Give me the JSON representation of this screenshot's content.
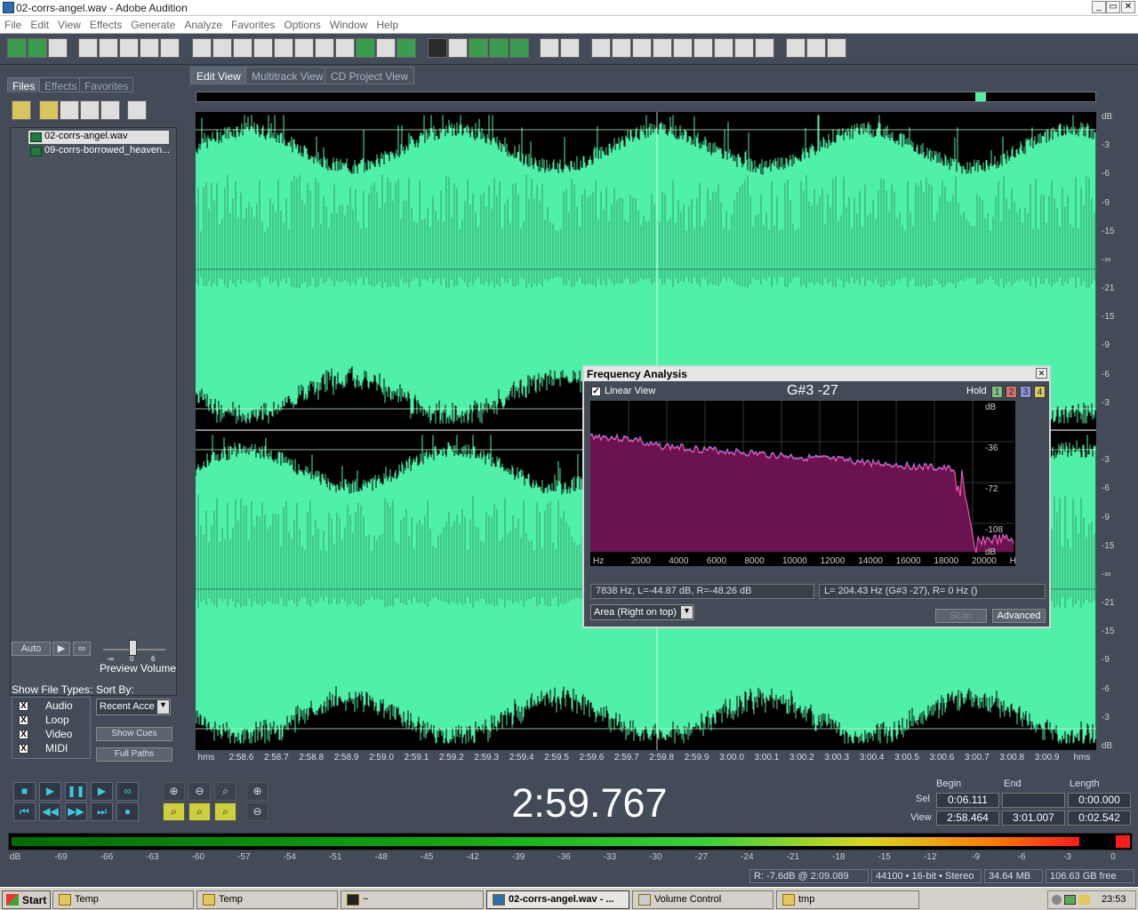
{
  "window": {
    "title": "02-corrs-angel.wav - Adobe Audition",
    "controls": [
      "_",
      "▭",
      "✕"
    ]
  },
  "menu": [
    "File",
    "Edit",
    "View",
    "Effects",
    "Generate",
    "Analyze",
    "Favorites",
    "Options",
    "Window",
    "Help"
  ],
  "left_panel": {
    "tabs": [
      "Files",
      "Effects",
      "Favorites"
    ],
    "files": [
      "02-corrs-angel.wav",
      "09-corrs-borrowed_heaven..."
    ],
    "auto_label": "Auto",
    "preview_volume_label": "Preview Volume",
    "preview_scale": [
      "-∞",
      "0",
      "6"
    ],
    "show_file_types_label": "Show File Types:",
    "sort_by_label": "Sort By:",
    "sort_value": "Recent Acce",
    "file_types": [
      "Audio",
      "Loop",
      "Video",
      "MIDI"
    ],
    "show_cues": "Show Cues",
    "full_paths": "Full Paths"
  },
  "view_tabs": [
    "Edit View",
    "Multitrack View",
    "CD Project View"
  ],
  "db_scale": [
    "dB",
    "-3",
    "-6",
    "-9",
    "-15",
    "-∞",
    "-21",
    "-15",
    "-9",
    "-6",
    "-3",
    "",
    "-3",
    "-6",
    "-9",
    "-15",
    "-∞",
    "-21",
    "-15",
    "-9",
    "-6",
    "-3",
    "dB"
  ],
  "timeline": [
    "hms",
    "2:58.6",
    "2:58.7",
    "2:58.8",
    "2:58.9",
    "2:59.0",
    "2:59.1",
    "2:59.2",
    "2:59.3",
    "2:59.4",
    "2:59.5",
    "2:59.6",
    "2:59.7",
    "2:59.8",
    "2:59.9",
    "3:00.0",
    "3:00.1",
    "3:00.2",
    "3:00.3",
    "3:00.4",
    "3:00.5",
    "3:00.6",
    "3:00.7",
    "3:00.8",
    "3:00.9",
    "hms"
  ],
  "freq_dialog": {
    "title": "Frequency Analysis",
    "linear_view": "Linear View",
    "note": "G#3 -27",
    "hold": "Hold",
    "hold_buttons": [
      "1",
      "2",
      "3",
      "4"
    ],
    "x_ticks": [
      "Hz",
      "2000",
      "4000",
      "6000",
      "8000",
      "10000",
      "12000",
      "14000",
      "16000",
      "18000",
      "20000",
      "Hz"
    ],
    "y_ticks": [
      "dB",
      "-36",
      "-72",
      "-108",
      "dB"
    ],
    "readout_left": "7838 Hz, L=-44.87 dB, R=-48.26 dB",
    "readout_right": "L= 204.43 Hz (G#3 -27), R=      0 Hz ()",
    "plot_mode": "Area (Right on top)",
    "scan": "Scan",
    "advanced": "Advanced"
  },
  "transport": {
    "time": "2:59.767",
    "headers": [
      "Begin",
      "End",
      "Length"
    ],
    "sel_label": "Sel",
    "view_label": "View",
    "sel": [
      "0:06.111",
      "",
      "0:00.000"
    ],
    "view": [
      "2:58.464",
      "3:01.007",
      "0:02.542"
    ]
  },
  "meter_scale": [
    "dB",
    "-69",
    "-66",
    "-63",
    "-60",
    "-57",
    "-54",
    "-51",
    "-48",
    "-45",
    "-42",
    "-39",
    "-36",
    "-33",
    "-30",
    "-27",
    "-24",
    "-21",
    "-18",
    "-15",
    "-12",
    "-9",
    "-6",
    "-3",
    "0"
  ],
  "meter_level": 0.98,
  "status": {
    "level": "R: -7.6dB @   2:09.089",
    "format": "44100 • 16-bit • Stereo",
    "size": "34.64 MB",
    "free": "106.63 GB free"
  },
  "taskbar": {
    "start": "Start",
    "tasks": [
      "Temp",
      "Temp",
      "~",
      "02-corrs-angel.wav - ...",
      "Volume Control",
      "tmp"
    ],
    "clock": "23:53"
  },
  "colors": {
    "waveform": "#4ff0a8",
    "spectrum_fill": "#6b1350",
    "spectrum_line_left": "#ff4aa0",
    "spectrum_line_right": "#5a8cff"
  }
}
